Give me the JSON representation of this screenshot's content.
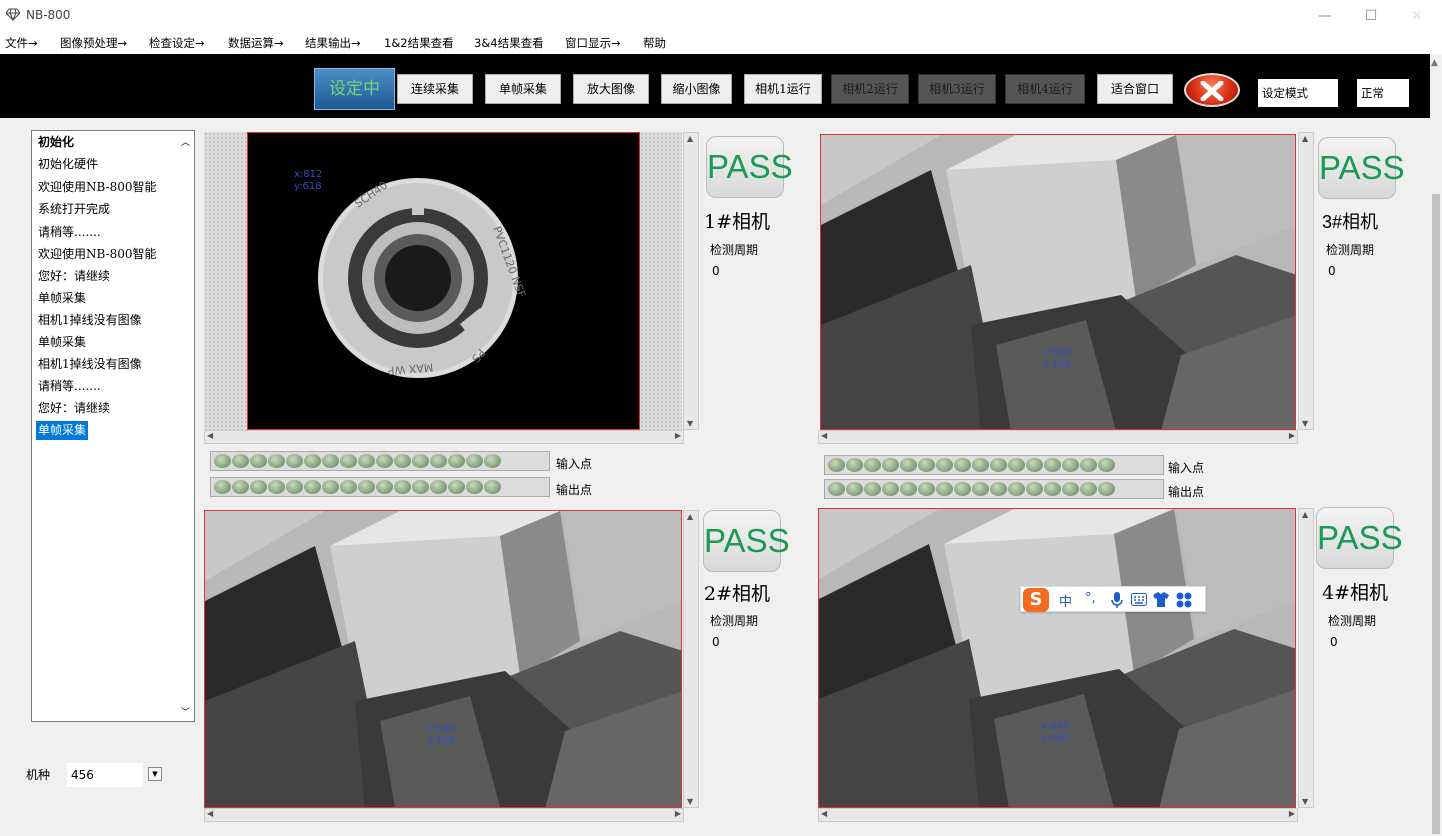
{
  "window": {
    "title": "NB-800",
    "minimize": "—",
    "maximize": "☐",
    "close": "✕"
  },
  "menu": [
    "文件→",
    "图像预处理→",
    "检查设定→",
    "数据运算→",
    "结果输出→",
    "1&2结果查看",
    "3&4结果查看",
    "窗口显示→",
    "帮助"
  ],
  "toolbar": {
    "setting_btn": "设定中",
    "continuous": "连续采集",
    "single": "单帧采集",
    "zoom_in": "放大图像",
    "zoom_out": "缩小图像",
    "cam1_run": "相机1运行",
    "cam2_run": "相机2运行",
    "cam3_run": "相机3运行",
    "cam4_run": "相机4运行",
    "fit_window": "适合窗口",
    "mode": "设定模式",
    "status": "正常"
  },
  "log": [
    "初始化",
    "初始化硬件",
    "欢迎使用NB-800智能",
    "系统打开完成",
    "请稍等.......",
    "欢迎使用NB-800智能",
    "您好：请继续",
    "单帧采集",
    "相机1掉线没有图像",
    "单帧采集",
    "相机1掉线没有图像",
    "请稍等.......",
    "您好：请继续",
    "单帧采集"
  ],
  "model": {
    "label": "机种",
    "value": "456"
  },
  "cameras": [
    {
      "result": "PASS",
      "name": "1#相机",
      "period_label": "检测周期",
      "period": "0",
      "coord_x": "x:812",
      "coord_y": "y:618"
    },
    {
      "result": "PASS",
      "name": "2#相机",
      "period_label": "检测周期",
      "period": "0",
      "coord_x": "x:640",
      "coord_y": "y:400"
    },
    {
      "result": "PASS",
      "name": "3#相机",
      "period_label": "检测周期",
      "period": "0",
      "coord_x": "x:640",
      "coord_y": "y:400"
    },
    {
      "result": "PASS",
      "name": "4#相机",
      "period_label": "检测周期",
      "period": "0",
      "coord_x": "x:640",
      "coord_y": "y:400"
    }
  ],
  "io": {
    "input_label": "输入点",
    "output_label": "输出点",
    "count": 16
  },
  "part_text": {
    "a": "SCH40",
    "b": "PVC1120 NSF",
    "c": "MAX WP",
    "d": "PS"
  },
  "ime": {
    "logo": "S",
    "lang": "中",
    "punct": "°,"
  },
  "colors": {
    "pass_green": "#1a9a52",
    "accent_blue": "#0078d7",
    "toolbar_bg": "#000000"
  }
}
